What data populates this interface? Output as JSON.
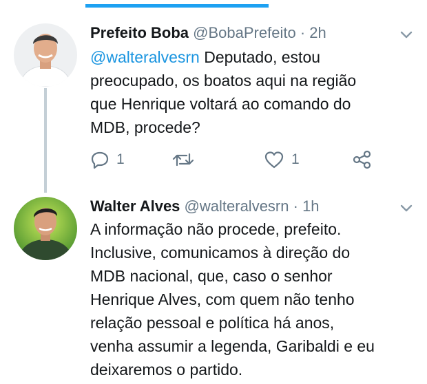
{
  "colors": {
    "accent": "#1da1f2",
    "link": "#1b95e0",
    "muted": "#657786",
    "thread_line": "#c4cfd6"
  },
  "tweets": [
    {
      "name": "Prefeito Boba",
      "handle": "@BobaPrefeito",
      "separator": "·",
      "time": "2h",
      "mention": "@walteralvesrn",
      "lines": [
        "Deputado, estou",
        "preocupado, os boatos aqui na região",
        "que Henrique voltará ao comando do",
        "MDB, procede?"
      ],
      "actions": {
        "reply_icon": "reply-icon",
        "reply_count": "1",
        "retweet_icon": "retweet-icon",
        "like_icon": "like-icon",
        "like_count": "1",
        "share_icon": "share-icon"
      }
    },
    {
      "name": "Walter Alves",
      "handle": "@walteralvesrn",
      "separator": "·",
      "time": "1h",
      "lines": [
        "A informação não procede, prefeito.",
        "Inclusive, comunicamos à direção do",
        "MDB nacional, que, caso o senhor",
        "Henrique Alves, com quem não tenho",
        "relação pessoal e política há anos,",
        "venha assumir a legenda, Garibaldi e eu",
        "deixaremos o partido."
      ]
    }
  ]
}
